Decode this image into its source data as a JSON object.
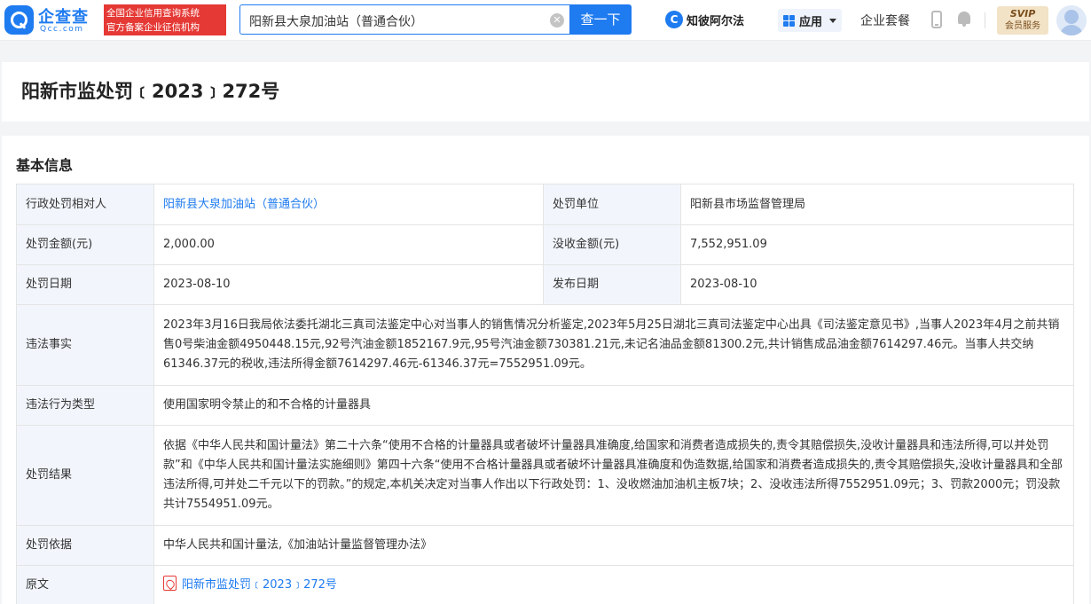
{
  "header": {
    "logo_name": "企查查",
    "logo_domain": "Qcc.com",
    "slogan_line1": "全国企业信用查询系统",
    "slogan_line2": "官方备案企业征信机构",
    "search_value": "阳新县大泉加油站（普通合伙）",
    "search_button": "查一下",
    "zhibi_icon_char": "C",
    "zhibi_label": "知彼阿尔法",
    "apps_label": "应用",
    "taocan_label": "企业套餐",
    "svip_title": "SVIP",
    "svip_sub": "会员服务"
  },
  "page": {
    "title": "阳新市监处罚﹝2023﹞272号"
  },
  "info": {
    "section_title": "基本信息",
    "rows": {
      "party_label": "行政处罚相对人",
      "party_value": "阳新县大泉加油站（普通合伙）",
      "unit_label": "处罚单位",
      "unit_value": "阳新县市场监督管理局",
      "amount_label": "处罚金额(元)",
      "amount_value": "2,000.00",
      "confiscate_label": "没收金额(元)",
      "confiscate_value": "7,552,951.09",
      "date_label": "处罚日期",
      "date_value": "2023-08-10",
      "publish_label": "发布日期",
      "publish_value": "2023-08-10",
      "facts_label": "违法事实",
      "facts_value": "2023年3月16日我局依法委托湖北三真司法鉴定中心对当事人的销售情况分析鉴定,2023年5月25日湖北三真司法鉴定中心出具《司法鉴定意见书》,当事人2023年4月之前共销售0号柴油金额4950448.15元,92号汽油金额1852167.9元,95号汽油金额730381.21元,未记名油品金额81300.2元,共计销售成品油金额7614297.46元。当事人共交纳61346.37元的税收,违法所得金额7614297.46元-61346.37元=7552951.09元。",
      "type_label": "违法行为类型",
      "type_value": "使用国家明令禁止的和不合格的计量器具",
      "result_label": "处罚结果",
      "result_value": "依据《中华人民共和国计量法》第二十六条“使用不合格的计量器具或者破坏计量器具准确度,给国家和消费者造成损失的,责令其赔偿损失,没收计量器具和违法所得,可以并处罚款”和《中华人民共和国计量法实施细则》第四十六条“使用不合格计量器具或者破坏计量器具准确度和伪造数据,给国家和消费者造成损失的,责令其赔偿损失,没收计量器具和全部违法所得,可并处二千元以下的罚款。”的规定,本机关决定对当事人作出以下行政处罚：1、没收燃油加油机主板7块；2、没收违法所得7552951.09元；3、罚款2000元；罚没款共计7554951.09元。",
      "basis_label": "处罚依据",
      "basis_value": "中华人民共和国计量法,《加油站计量监督管理办法》",
      "original_label": "原文",
      "original_value": "阳新市监处罚﹝2023﹞272号"
    }
  }
}
